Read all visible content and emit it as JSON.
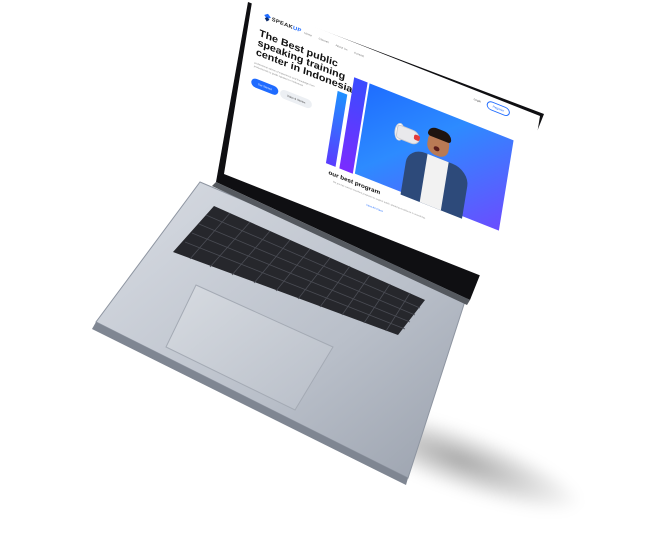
{
  "site": {
    "brand_prefix": "SPEAK",
    "brand_suffix": "UP",
    "nav_links": [
      "Home",
      "Classes",
      "About Us",
      "Contact"
    ],
    "login_label": "Login",
    "register_label": "Register",
    "hero_title": "The Best public speaking training center in Indonesia",
    "hero_subtitle": "professional advice of experience and knowledge from professionals to guide speakers in Indonesia",
    "primary_button": "Get Started",
    "secondary_button": "Video & Stories",
    "section_title": "our best program",
    "section_subtitle": "We provide various excellent programs to support public speaking excellence in everything.",
    "more_link": "View All Class"
  },
  "colors": {
    "accent": "#1f6bff",
    "laptop_body": "#c4c9d2",
    "screen_bezel": "#111111",
    "keyboard": "#2a2b30"
  }
}
